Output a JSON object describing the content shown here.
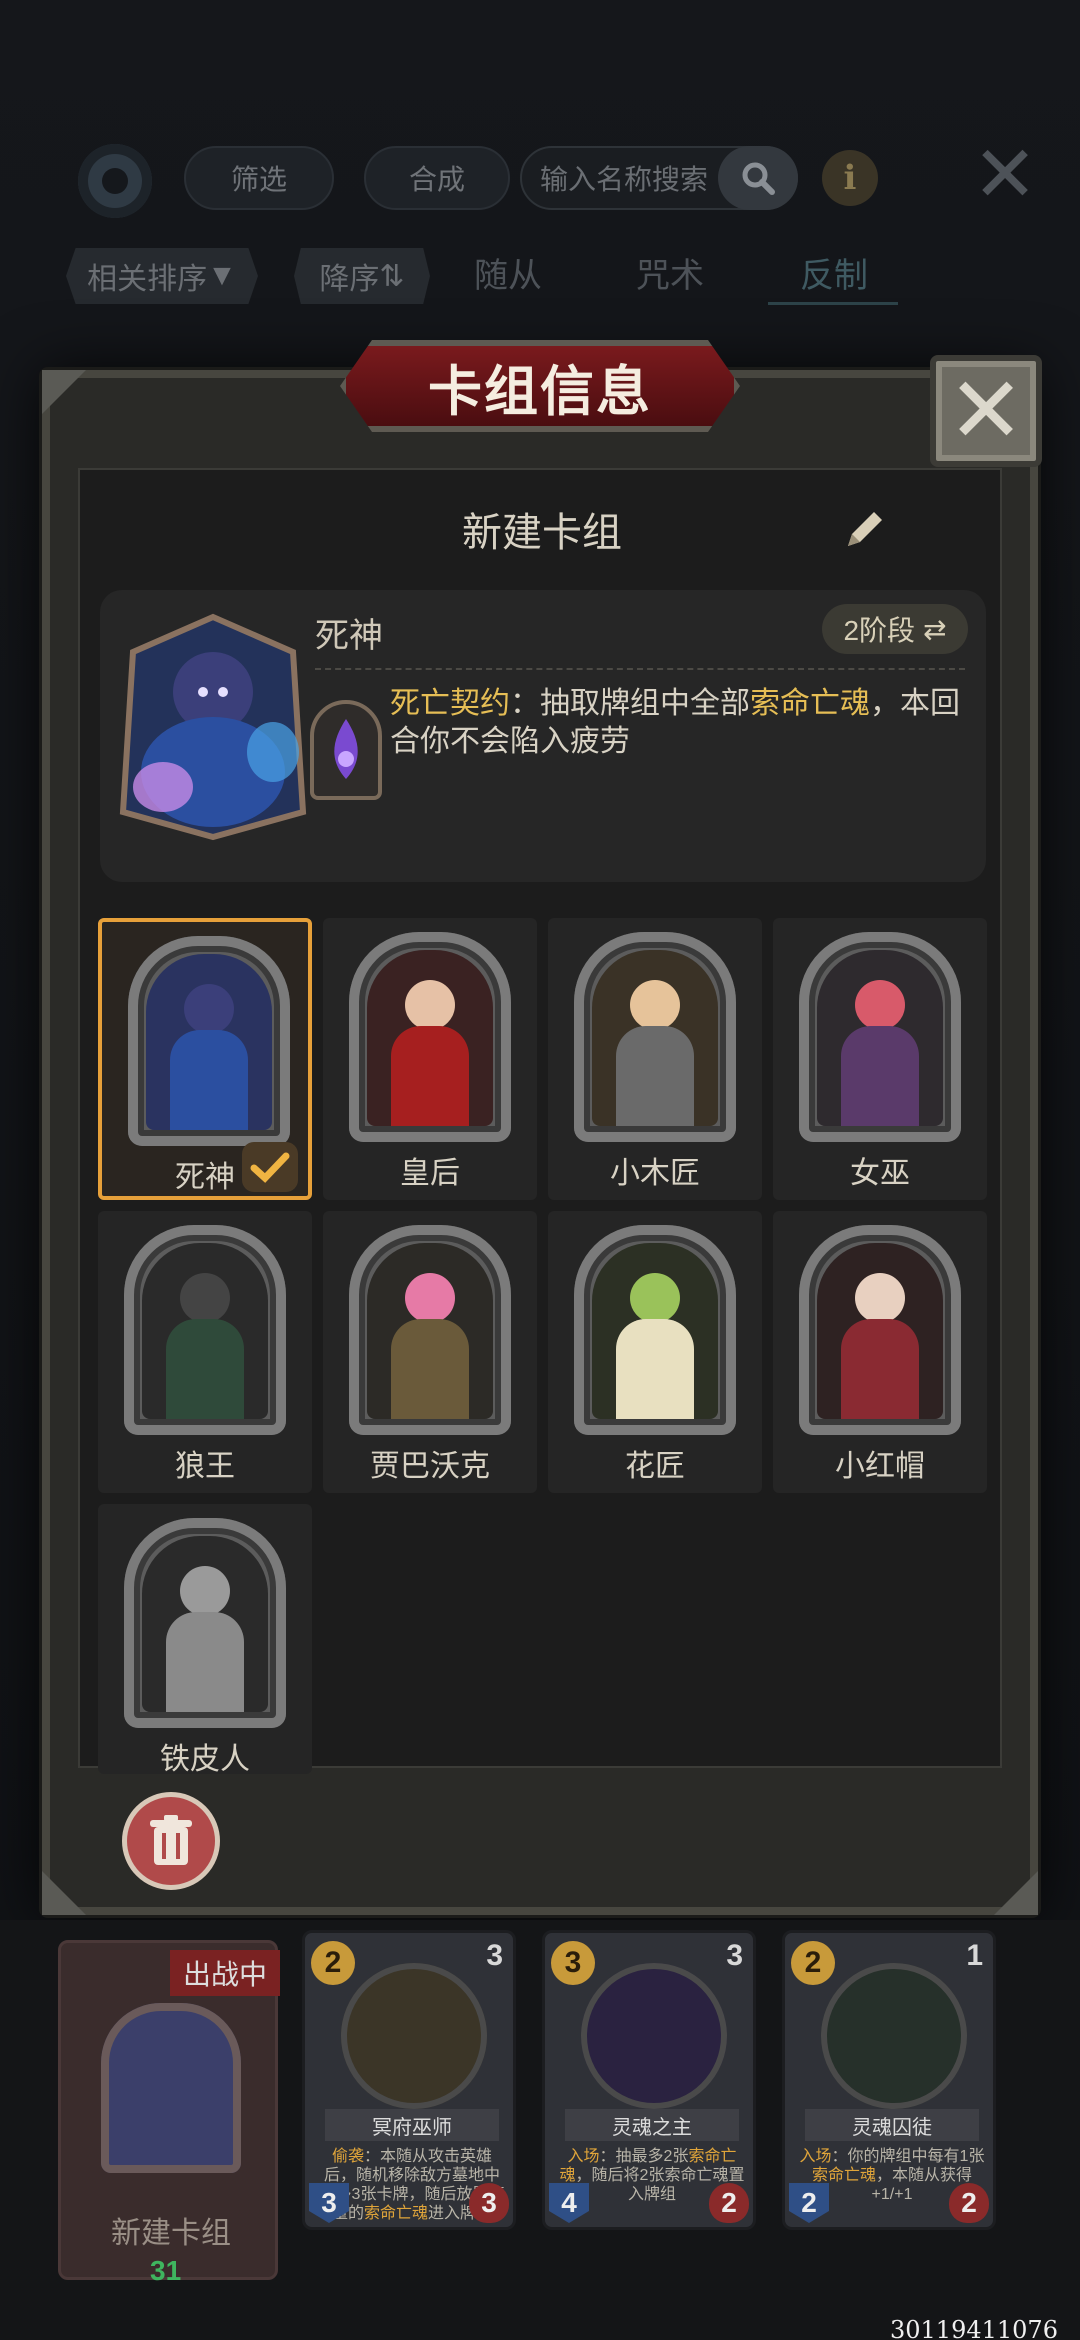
{
  "topbar": {
    "filter_label": "筛选",
    "craft_label": "合成",
    "search_placeholder": "输入名称搜索"
  },
  "sortbar": {
    "sort_label": "相关排序",
    "order_label": "降序",
    "tabs": [
      {
        "label": "随从"
      },
      {
        "label": "咒术"
      },
      {
        "label": "反制"
      }
    ]
  },
  "dialog": {
    "title": "卡组信息",
    "deck_name": "新建卡组",
    "hero": {
      "name": "死神",
      "stage": "2阶段",
      "skill_name": "死亡契约",
      "skill_pre": "：抽取牌组中全部",
      "skill_keyword": "索命亡魂",
      "skill_post": "，本回合你不会陷入疲劳"
    },
    "heroes": [
      {
        "name": "死神",
        "selected": true
      },
      {
        "name": "皇后",
        "selected": false
      },
      {
        "name": "小木匠",
        "selected": false
      },
      {
        "name": "女巫",
        "selected": false
      },
      {
        "name": "狼王",
        "selected": false
      },
      {
        "name": "贾巴沃克",
        "selected": false
      },
      {
        "name": "花匠",
        "selected": false
      },
      {
        "name": "小红帽",
        "selected": false
      },
      {
        "name": "铁皮人",
        "selected": false
      }
    ]
  },
  "bottom": {
    "deck_slot_name": "新建卡组",
    "in_battle_label": "出战中",
    "deck_count": "31",
    "cards": [
      {
        "cost": "2",
        "rank": "3",
        "name": "冥府巫师",
        "atk": "3",
        "hp": "3",
        "kw": "偷袭",
        "text": "：本随从攻击英雄后，随机移除敌方墓地中至多3张卡牌，随后放置等量的",
        "kw2": "索命亡魂",
        "text2": "进入牌组"
      },
      {
        "cost": "3",
        "rank": "3",
        "name": "灵魂之主",
        "atk": "4",
        "hp": "2",
        "kw": "入场",
        "text": "：抽最多2张",
        "kw2": "索命亡魂",
        "text2": "，随后将2张索命亡魂置入牌组"
      },
      {
        "cost": "2",
        "rank": "1",
        "name": "灵魂囚徒",
        "atk": "2",
        "hp": "2",
        "kw": "入场",
        "text": "：你的牌组中每有1张",
        "kw2": "索命亡魂",
        "text2": "，本随从获得+1/+1"
      }
    ]
  },
  "footer_id": "30119411076",
  "colors": {
    "accent_gold": "#e6be55",
    "select_orange": "#e6a03a",
    "title_red": "#7a1a1d"
  }
}
